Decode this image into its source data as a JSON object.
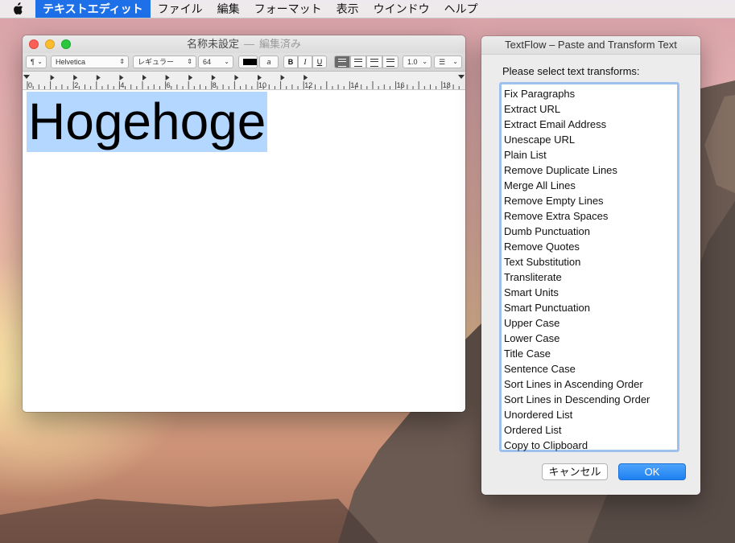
{
  "menubar": {
    "app_name": "テキストエディット",
    "items": [
      "ファイル",
      "編集",
      "フォーマット",
      "表示",
      "ウインドウ",
      "ヘルプ"
    ]
  },
  "textedit": {
    "title": "名称未設定",
    "separator": "—",
    "status": "編集済み",
    "toolbar": {
      "paragraph_symbol": "¶",
      "font_family": "Helvetica",
      "font_style": "レギュラー",
      "font_size": "64",
      "bold": "B",
      "italic": "I",
      "underline": "U",
      "line_spacing": "1.0"
    },
    "ruler_labels": [
      "0",
      "2",
      "4",
      "6",
      "8",
      "10",
      "12",
      "14",
      "16",
      "18"
    ],
    "document_text": "Hogehoge"
  },
  "textflow": {
    "title": "TextFlow – Paste and Transform Text",
    "prompt": "Please select text transforms:",
    "transforms": [
      "Fix Paragraphs",
      "Extract URL",
      "Extract Email Address",
      "Unescape URL",
      "Plain List",
      "Remove Duplicate Lines",
      "Merge All Lines",
      "Remove Empty Lines",
      "Remove Extra Spaces",
      "Dumb Punctuation",
      "Remove Quotes",
      "Text Substitution",
      "Transliterate",
      "Smart Units",
      "Smart Punctuation",
      "Upper Case",
      "Lower Case",
      "Title Case",
      "Sentence Case",
      "Sort Lines in Ascending Order",
      "Sort Lines in Descending Order",
      "Unordered List",
      "Ordered List",
      "Copy to Clipboard"
    ],
    "cancel_label": "キャンセル",
    "ok_label": "OK"
  },
  "colors": {
    "accent": "#1e70e8",
    "selection": "#b3d7ff",
    "list_focus_ring": "#9ec1eb"
  }
}
